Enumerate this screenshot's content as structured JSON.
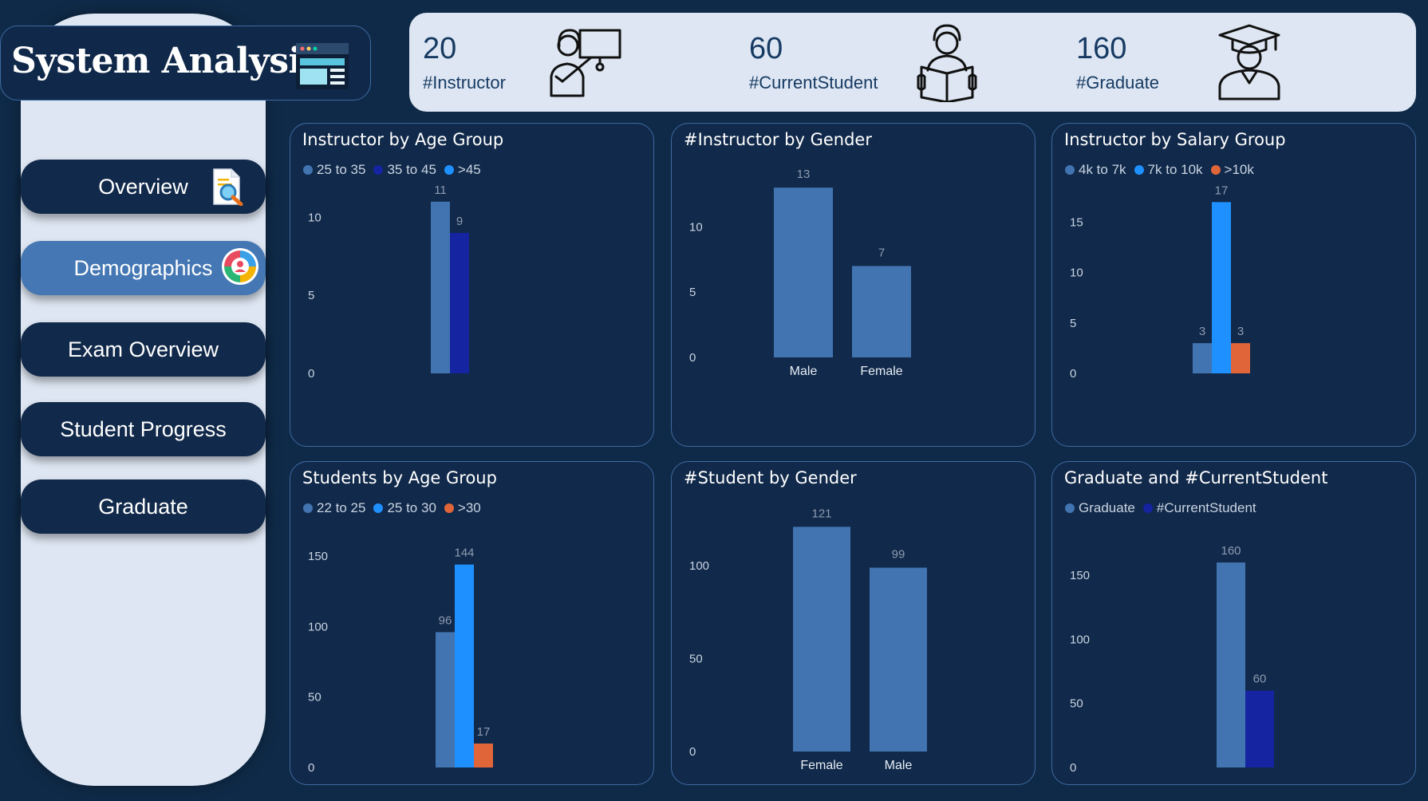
{
  "app_title": "System Analysis",
  "nav": [
    {
      "label": "Overview",
      "active": false,
      "icon": "search-document-icon"
    },
    {
      "label": "Demographics",
      "active": true,
      "icon": "pie-chart-icon"
    },
    {
      "label": "Exam Overview",
      "active": false
    },
    {
      "label": "Student Progress",
      "active": false
    },
    {
      "label": "Graduate",
      "active": false
    }
  ],
  "kpis": [
    {
      "value": "20",
      "label": "#Instructor",
      "icon": "instructor-icon"
    },
    {
      "value": "60",
      "label": "#CurrentStudent",
      "icon": "student-reading-icon"
    },
    {
      "value": "160",
      "label": "#Graduate",
      "icon": "graduate-icon"
    }
  ],
  "colors": {
    "c1": "#4174b0",
    "c2": "#1524a0",
    "c3": "#1e90ff",
    "c4": "#e0663a"
  },
  "chart_data": [
    {
      "type": "bar",
      "title": "Instructor by Age Group",
      "series": [
        {
          "name": "25 to 35",
          "values": [
            11
          ],
          "color": "#4174b0"
        },
        {
          "name": "35 to 45",
          "values": [
            9
          ],
          "color": "#1524a0"
        },
        {
          "name": ">45",
          "values": [
            0
          ],
          "color": "#1e90ff"
        }
      ],
      "yticks": [
        0,
        5,
        10
      ],
      "ylim": [
        0,
        11.5
      ],
      "categories": [],
      "grouped": true
    },
    {
      "type": "bar",
      "title": "#Instructor by Gender",
      "categories": [
        "Male",
        "Female"
      ],
      "values": [
        13,
        7
      ],
      "yticks": [
        0,
        5,
        10
      ],
      "ylim": [
        0,
        13.5
      ]
    },
    {
      "type": "bar",
      "title": "Instructor by Salary Group",
      "series": [
        {
          "name": "4k to 7k",
          "values": [
            3
          ],
          "color": "#4174b0"
        },
        {
          "name": "7k to 10k",
          "values": [
            17
          ],
          "color": "#1e90ff"
        },
        {
          "name": ">10k",
          "values": [
            3
          ],
          "color": "#e0663a"
        }
      ],
      "yticks": [
        0,
        5,
        10,
        15
      ],
      "ylim": [
        0,
        17.5
      ],
      "categories": [],
      "grouped": true
    },
    {
      "type": "bar",
      "title": "Students by Age Group",
      "series": [
        {
          "name": "22 to 25",
          "values": [
            96
          ],
          "color": "#4174b0"
        },
        {
          "name": "25 to 30",
          "values": [
            144
          ],
          "color": "#1e90ff"
        },
        {
          "name": ">30",
          "values": [
            17
          ],
          "color": "#e0663a"
        }
      ],
      "yticks": [
        0,
        50,
        100,
        150
      ],
      "ylim": [
        0,
        150
      ],
      "categories": [],
      "grouped": true
    },
    {
      "type": "bar",
      "title": "#Student by Gender",
      "categories": [
        "Female",
        "Male"
      ],
      "values": [
        121,
        99
      ],
      "yticks": [
        0,
        50,
        100
      ],
      "ylim": [
        0,
        125
      ]
    },
    {
      "type": "bar",
      "title": "Graduate and #CurrentStudent",
      "series": [
        {
          "name": "Graduate",
          "values": [
            160
          ],
          "color": "#4174b0"
        },
        {
          "name": "#CurrentStudent",
          "values": [
            60
          ],
          "color": "#1524a0"
        }
      ],
      "yticks": [
        0,
        50,
        100,
        150
      ],
      "ylim": [
        0,
        165
      ],
      "categories": [],
      "grouped": true
    }
  ]
}
